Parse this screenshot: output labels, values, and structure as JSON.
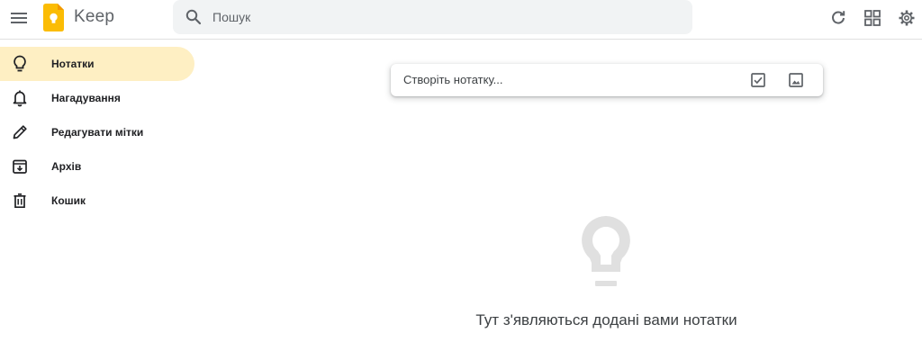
{
  "header": {
    "menu_icon": "hamburger-menu-icon",
    "logo_icon": "keep-logo",
    "app_name": "Keep",
    "search": {
      "placeholder": "Пошук",
      "value": "",
      "icon": "search-icon"
    },
    "actions": [
      {
        "name": "refresh",
        "icon": "refresh-icon"
      },
      {
        "name": "grid-view",
        "icon": "grid-view-icon"
      },
      {
        "name": "settings",
        "icon": "gear-icon"
      }
    ]
  },
  "sidebar": {
    "items": [
      {
        "label": "Нотатки",
        "icon": "lightbulb-icon",
        "active": true
      },
      {
        "label": "Нагадування",
        "icon": "bell-icon",
        "active": false
      },
      {
        "label": "Редагувати мітки",
        "icon": "pencil-icon",
        "active": false
      },
      {
        "label": "Архів",
        "icon": "archive-icon",
        "active": false
      },
      {
        "label": "Кошик",
        "icon": "trash-icon",
        "active": false
      }
    ]
  },
  "composer": {
    "placeholder": "Створіть нотатку...",
    "actions": [
      {
        "name": "new-list",
        "icon": "checkbox-icon"
      },
      {
        "name": "new-image-note",
        "icon": "image-icon"
      }
    ]
  },
  "empty_state": {
    "icon": "lightbulb-outline-icon",
    "message": "Тут з'являються додані вами нотатки"
  },
  "colors": {
    "active_nav_bg": "#feefc3",
    "search_bg": "#f1f3f4",
    "logo_yellow": "#fbbc04",
    "icon_grey": "#5f6368",
    "empty_icon_grey": "#e0e0e0"
  }
}
